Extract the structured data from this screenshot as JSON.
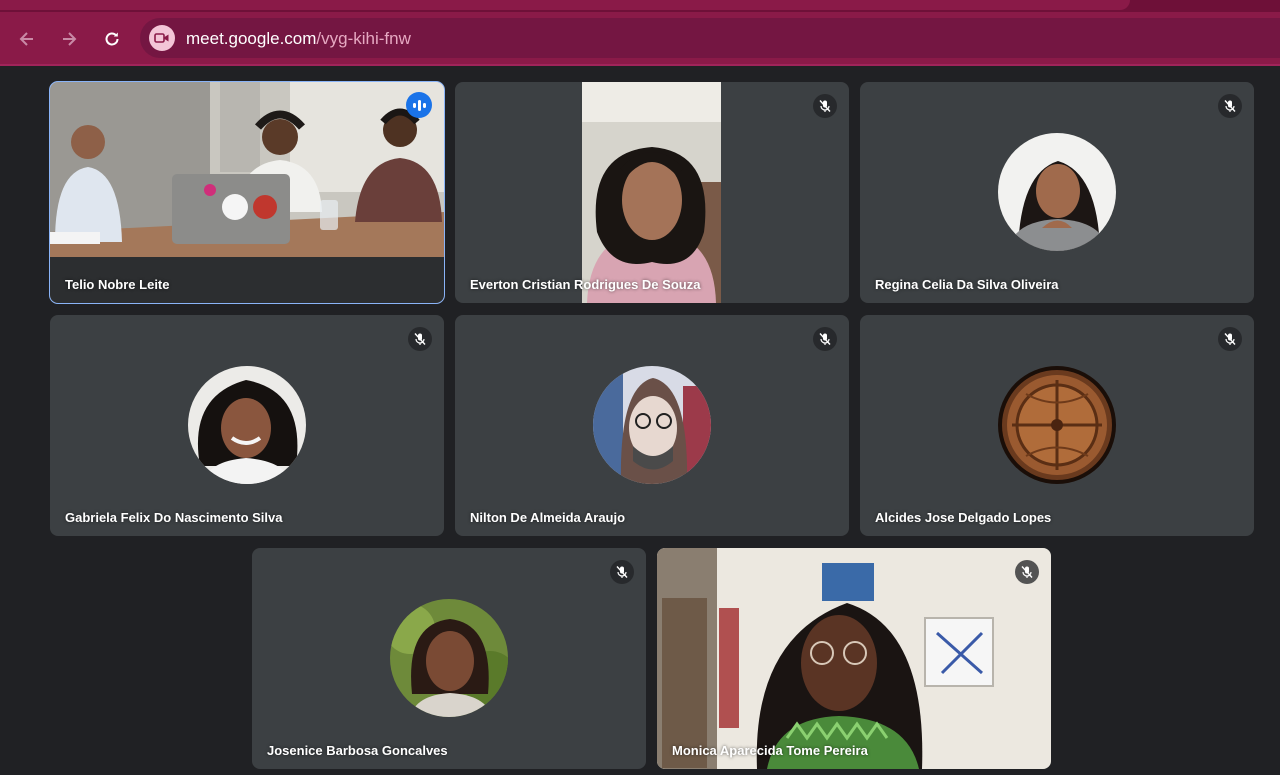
{
  "browser": {
    "url_host": "meet.google.com",
    "url_path": "/vyg-kihi-fnw",
    "icons": {
      "back": "arrow-left-icon",
      "forward": "arrow-right-icon",
      "reload": "reload-icon",
      "site": "video-camera-icon"
    }
  },
  "meeting": {
    "participants": [
      {
        "name": "Telio Nobre Leite",
        "speaking": true,
        "muted": false,
        "media": "camera"
      },
      {
        "name": "Everton Cristian Rodrigues De Souza",
        "muted": true,
        "media": "camera"
      },
      {
        "name": "Regina Celia Da Silva Oliveira",
        "muted": true,
        "media": "avatar"
      },
      {
        "name": "Gabriela Felix Do Nascimento Silva",
        "muted": true,
        "media": "avatar"
      },
      {
        "name": "Nilton De Almeida Araujo",
        "muted": true,
        "media": "avatar"
      },
      {
        "name": "Alcides Jose Delgado Lopes",
        "muted": true,
        "media": "avatar"
      },
      {
        "name": "Josenice Barbosa Goncalves",
        "muted": true,
        "media": "avatar"
      },
      {
        "name": "Monica Aparecida Tome Pereira",
        "muted": true,
        "media": "camera"
      }
    ]
  },
  "colors": {
    "toolbar": "#8a1a48",
    "background": "#202124",
    "tile": "#3c4043",
    "active_outline": "#8ab4f8"
  }
}
